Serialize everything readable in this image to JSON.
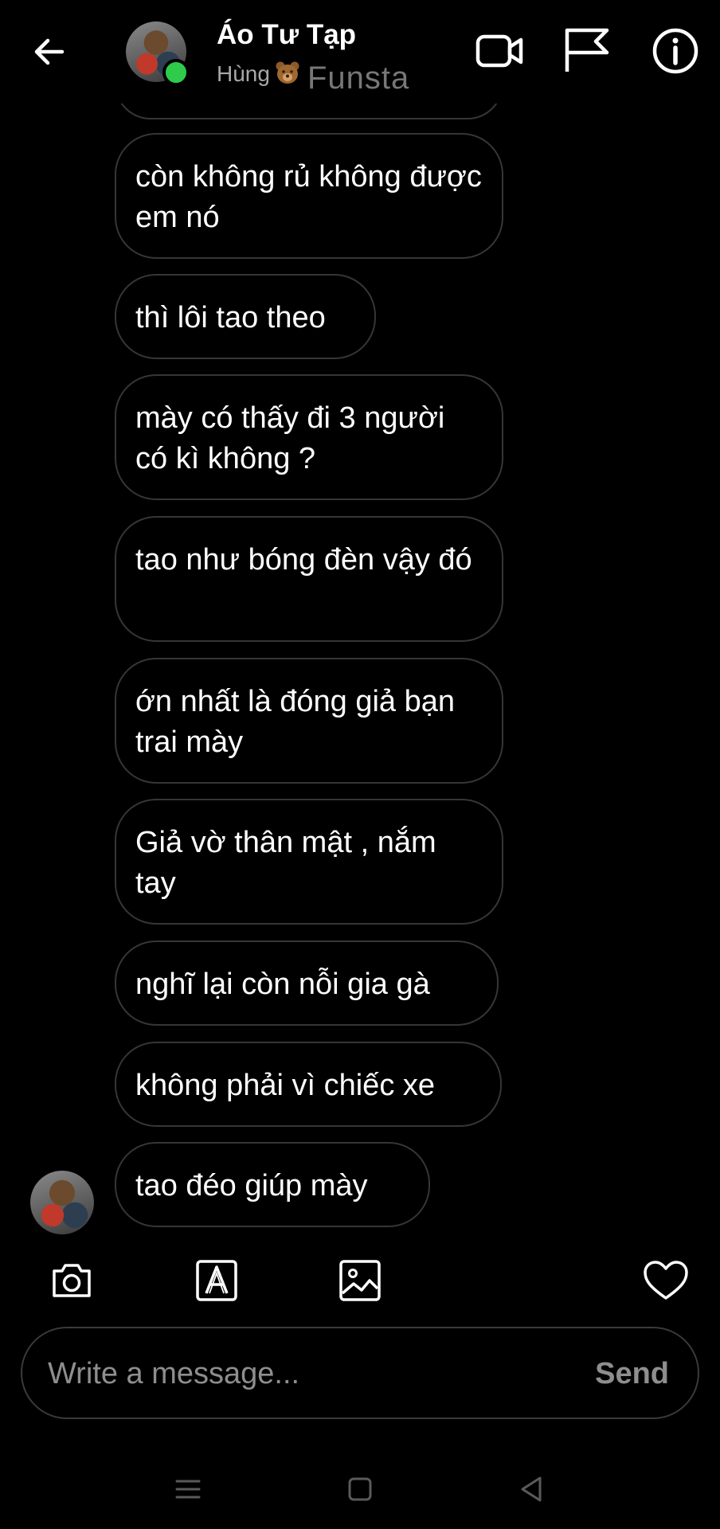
{
  "header": {
    "title": "Áo Tư Tạp",
    "subtitle": "Hùng",
    "watermark": "Funsta"
  },
  "messages": [
    {
      "text": "còn không rủ không được em nó"
    },
    {
      "text": "thì lôi tao theo"
    },
    {
      "text": "mày có thấy đi 3 người có kì không ?"
    },
    {
      "text": "tao như bóng đèn vậy đó"
    },
    {
      "text": "ớn nhất là đóng giả bạn trai mày"
    },
    {
      "text": "Giả vờ thân mật , nắm tay"
    },
    {
      "text": "nghĩ lại còn nỗi gia gà"
    },
    {
      "text": "không phải vì chiếc xe"
    },
    {
      "text": "tao đéo giúp mày"
    }
  ],
  "composer": {
    "placeholder": "Write a message...",
    "send_label": "Send"
  },
  "colors": {
    "background": "#000000",
    "bubble_border": "#363636",
    "online": "#2ecc4a",
    "muted_text": "#8e8e8e"
  }
}
